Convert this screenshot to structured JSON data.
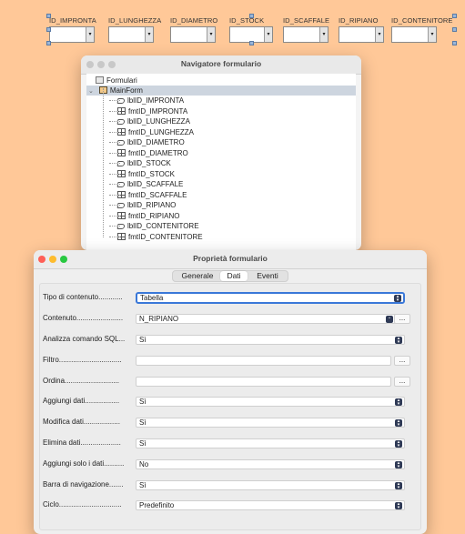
{
  "design_fields": [
    "ID_IMPRONTA",
    "ID_LUNGHEZZA",
    "ID_DIAMETRO",
    "ID_STOCK",
    "ID_SCAFFALE",
    "ID_RIPIANO",
    "ID_CONTENITORE"
  ],
  "navigator": {
    "title": "Navigatore formulario",
    "root": "Formulari",
    "form": "MainForm",
    "items": [
      {
        "label": "lblID_IMPRONTA",
        "kind": "label"
      },
      {
        "label": "fmtID_IMPRONTA",
        "kind": "field"
      },
      {
        "label": "lblID_LUNGHEZZA",
        "kind": "label"
      },
      {
        "label": "fmtID_LUNGHEZZA",
        "kind": "field"
      },
      {
        "label": "lblID_DIAMETRO",
        "kind": "label"
      },
      {
        "label": "fmtID_DIAMETRO",
        "kind": "field"
      },
      {
        "label": "lblID_STOCK",
        "kind": "label"
      },
      {
        "label": "fmtID_STOCK",
        "kind": "field"
      },
      {
        "label": "lblID_SCAFFALE",
        "kind": "label"
      },
      {
        "label": "fmtID_SCAFFALE",
        "kind": "field"
      },
      {
        "label": "lblID_RIPIANO",
        "kind": "label"
      },
      {
        "label": "fmtID_RIPIANO",
        "kind": "field"
      },
      {
        "label": "lblID_CONTENITORE",
        "kind": "label"
      },
      {
        "label": "fmtID_CONTENITORE",
        "kind": "field"
      }
    ]
  },
  "properties": {
    "title": "Proprietà formulario",
    "tabs": [
      "Generale",
      "Dati",
      "Eventi"
    ],
    "active_tab": "Dati",
    "dots_label": "...",
    "rows": [
      {
        "label": "Tipo di contenuto............",
        "value": "Tabella"
      },
      {
        "label": "Contenuto.......................",
        "value": "N_RIPIANO"
      },
      {
        "label": "Analizza comando SQL...",
        "value": "Sì"
      },
      {
        "label": "Filtro...............................",
        "value": ""
      },
      {
        "label": "Ordina...........................",
        "value": ""
      },
      {
        "label": "Aggiungi dati.................",
        "value": "Sì"
      },
      {
        "label": "Modifica dati..................",
        "value": "Sì"
      },
      {
        "label": "Elimina dati....................",
        "value": "Sì"
      },
      {
        "label": "Aggiungi solo i dati..........",
        "value": "No"
      },
      {
        "label": "Barra di navigazione.......",
        "value": "Sì"
      },
      {
        "label": "Ciclo...............................",
        "value": "Predefinito"
      }
    ]
  }
}
